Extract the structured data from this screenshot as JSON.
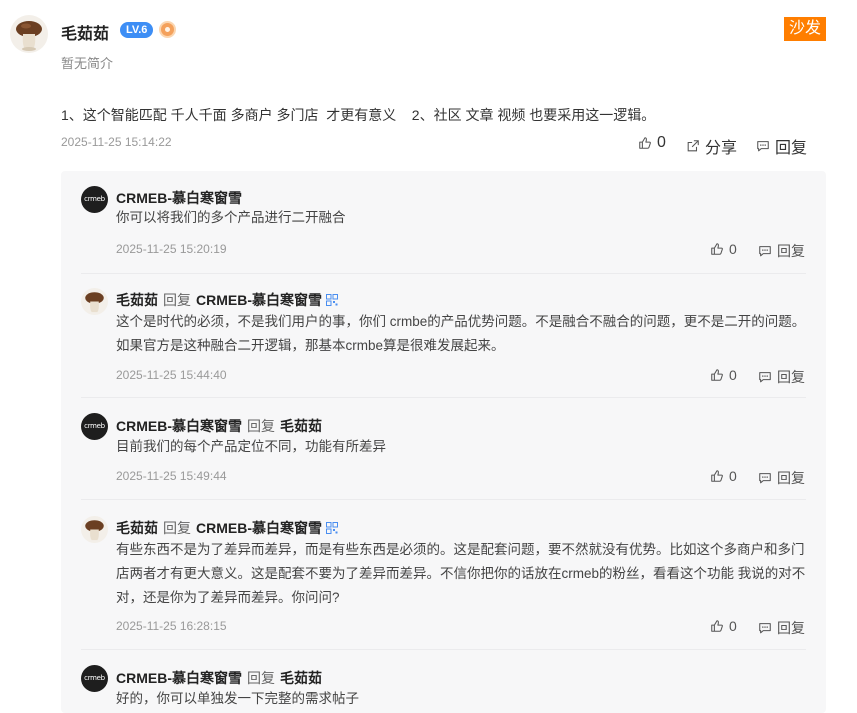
{
  "post": {
    "author": "毛茹茹",
    "level": "LV.6",
    "medal_icon": "medal-icon",
    "bio": "暂无简介",
    "sofa_label": "沙发",
    "content": "1、这个智能匹配 千人千面 多商户 多门店  才更有意义    2、社区 文章 视频 也要采用这一逻辑。",
    "time": "2025-11-25 15:14:22",
    "likes": "0",
    "share_label": "分享",
    "reply_label": "回复"
  },
  "reply_word": "回复",
  "replies": [
    {
      "author": "CRMEB-慕白寒窗雪",
      "target": "",
      "text": "你可以将我们的多个产品进行二开融合",
      "time": "2025-11-25 15:20:19",
      "likes": "0",
      "reply_label": "回复"
    },
    {
      "author": "毛茹茹",
      "target": "CRMEB-慕白寒窗雪",
      "text": "这个是时代的必须，不是我们用户的事，你们 crmbe的产品优势问题。不是融合不融合的问题，更不是二开的问题。如果官方是这种融合二开逻辑，那基本crmbe算是很难发展起来。",
      "time": "2025-11-25 15:44:40",
      "likes": "0",
      "reply_label": "回复"
    },
    {
      "author": "CRMEB-慕白寒窗雪",
      "target": "毛茹茹",
      "text": "目前我们的每个产品定位不同，功能有所差异",
      "time": "2025-11-25 15:49:44",
      "likes": "0",
      "reply_label": "回复"
    },
    {
      "author": "毛茹茹",
      "target": "CRMEB-慕白寒窗雪",
      "text": "有些东西不是为了差异而差异，而是有些东西是必须的。这是配套问题，要不然就没有优势。比如这个多商户和多门店两者才有更大意义。这是配套不要为了差异而差异。不信你把你的话放在crmeb的粉丝，看看这个功能 我说的对不对，还是你为了差异而差异。你问问?",
      "time": "2025-11-25 16:28:15",
      "likes": "0",
      "reply_label": "回复"
    },
    {
      "author": "CRMEB-慕白寒窗雪",
      "target": "毛茹茹",
      "text": "好的，你可以单独发一下完整的需求帖子"
    }
  ],
  "avatar_logo_text": "crmeb",
  "colors": {
    "accent_blue": "#3d8ef5",
    "sofa_orange": "#ff7e00",
    "reply_bg": "#f7f7f8"
  }
}
